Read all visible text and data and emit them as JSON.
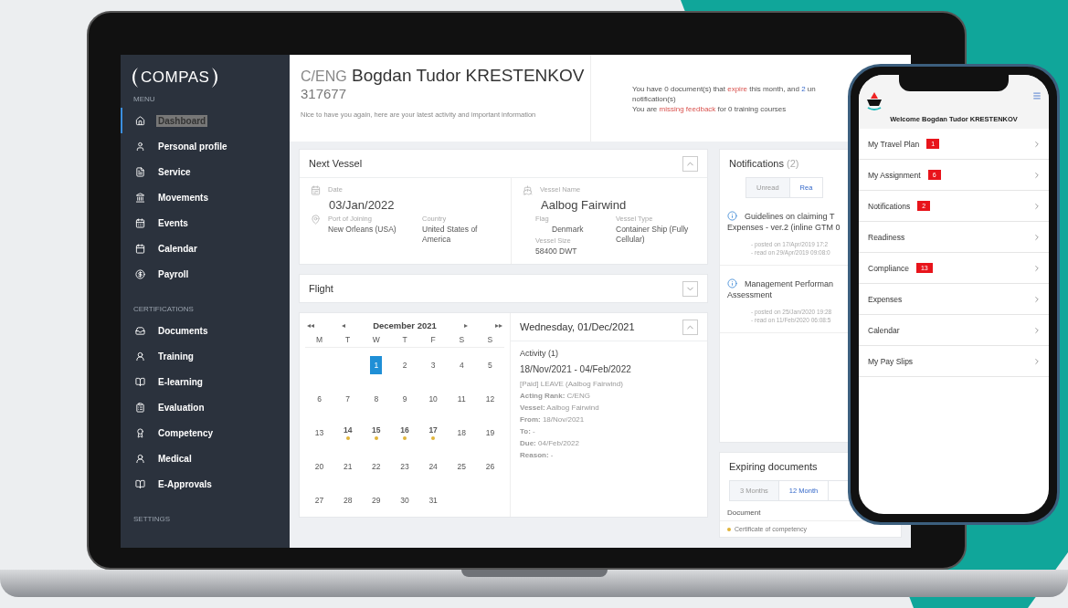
{
  "sidebar": {
    "logo": "COMPAS",
    "sections": [
      {
        "title": "MENU",
        "items": [
          {
            "label": "Dashboard",
            "selected": true
          },
          {
            "label": "Personal profile",
            "selected": false
          },
          {
            "label": "Service",
            "selected": false
          },
          {
            "label": "Movements",
            "selected": false
          },
          {
            "label": "Events",
            "selected": false
          },
          {
            "label": "Calendar",
            "selected": false
          },
          {
            "label": "Payroll",
            "selected": false
          }
        ]
      },
      {
        "title": "CERTIFICATIONS",
        "items": [
          {
            "label": "Documents",
            "selected": false
          },
          {
            "label": "Training",
            "selected": false
          },
          {
            "label": "E-learning",
            "selected": false
          },
          {
            "label": "Evaluation",
            "selected": false
          },
          {
            "label": "Competency",
            "selected": false
          },
          {
            "label": "Medical",
            "selected": false
          },
          {
            "label": "E-Approvals",
            "selected": false
          }
        ]
      },
      {
        "title": "SETTINGS"
      }
    ]
  },
  "header": {
    "rank": "C/ENG",
    "name": "Bogdan Tudor KRESTENKOV",
    "id": "317677",
    "greeting": "Nice to have you again, here are your latest activity and important information",
    "notice_lines": [
      [
        {
          "text": "You have 0 document(s) that ",
          "kind": "plain"
        },
        {
          "text": "expire",
          "kind": "alert"
        },
        {
          "text": " this month, and ",
          "kind": "plain"
        },
        {
          "text": "2",
          "kind": "link"
        },
        {
          "text": " un",
          "kind": "plain"
        }
      ],
      [
        {
          "text": "notification(s)",
          "kind": "plain"
        }
      ],
      [
        {
          "text": "You are ",
          "kind": "plain"
        },
        {
          "text": "missing feedback",
          "kind": "alert"
        },
        {
          "text": " for 0 training courses",
          "kind": "plain"
        }
      ]
    ]
  },
  "next_vessel": {
    "title": "Next Vessel",
    "expanded": true,
    "date_label": "Date",
    "date": "03/Jan/2022",
    "port_label": "Port of Joining",
    "port": "New Orleans (USA)",
    "country_label": "Country",
    "country": "United States of America",
    "vessel_label": "Vessel Name",
    "vessel": "Aalbog Fairwind",
    "flag_label": "Flag",
    "flag": "Denmark",
    "type_label": "Vessel Type",
    "type": "Container Ship (Fully Cellular)",
    "size_label": "Vessel Size",
    "size": "58400 DWT"
  },
  "flight": {
    "title": "Flight",
    "expanded": false
  },
  "calendar": {
    "nav": [
      "◂◂",
      "◂",
      "▸",
      "▸▸"
    ],
    "month": "December 2021",
    "weekdays": [
      "M",
      "T",
      "W",
      "T",
      "F",
      "S",
      "S"
    ],
    "days": [
      {
        "day": "1",
        "selected": true,
        "event": false
      },
      {
        "day": "2",
        "selected": false,
        "event": false
      },
      {
        "day": "3",
        "selected": false,
        "event": false
      },
      {
        "day": "4",
        "selected": false,
        "event": false
      },
      {
        "day": "5",
        "selected": false,
        "event": false
      },
      {
        "day": "6",
        "selected": false,
        "event": false
      },
      {
        "day": "7",
        "selected": false,
        "event": false
      },
      {
        "day": "8",
        "selected": false,
        "event": false
      },
      {
        "day": "9",
        "selected": false,
        "event": false
      },
      {
        "day": "10",
        "selected": false,
        "event": false
      },
      {
        "day": "11",
        "selected": false,
        "event": false
      },
      {
        "day": "12",
        "selected": false,
        "event": false
      },
      {
        "day": "13",
        "selected": false,
        "event": false
      },
      {
        "day": "14",
        "selected": false,
        "event": true
      },
      {
        "day": "15",
        "selected": false,
        "event": true
      },
      {
        "day": "16",
        "selected": false,
        "event": true
      },
      {
        "day": "17",
        "selected": false,
        "event": true
      },
      {
        "day": "18",
        "selected": false,
        "event": false
      },
      {
        "day": "19",
        "selected": false,
        "event": false
      },
      {
        "day": "20",
        "selected": false,
        "event": false
      },
      {
        "day": "21",
        "selected": false,
        "event": false
      },
      {
        "day": "22",
        "selected": false,
        "event": false
      },
      {
        "day": "23",
        "selected": false,
        "event": false
      },
      {
        "day": "24",
        "selected": false,
        "event": false
      },
      {
        "day": "25",
        "selected": false,
        "event": false
      },
      {
        "day": "26",
        "selected": false,
        "event": false
      },
      {
        "day": "27",
        "selected": false,
        "event": false
      },
      {
        "day": "28",
        "selected": false,
        "event": false
      },
      {
        "day": "29",
        "selected": false,
        "event": false
      },
      {
        "day": "30",
        "selected": false,
        "event": false
      },
      {
        "day": "31",
        "selected": false,
        "event": false
      }
    ]
  },
  "day_panel": {
    "title": "Wednesday, 01/Dec/2021",
    "expanded": true,
    "activity_title": "Activity (1)",
    "period": "18/Nov/2021 - 04/Feb/2022",
    "lines": [
      "[Paid] LEAVE (Aalbog Fairwind)",
      "**Acting Rank:** C/ENG",
      "**Vessel:** Aalbog Fairwind",
      "**From:** 18/Nov/2021",
      "**To:** -",
      "**Due:** 04/Feb/2022",
      "**Reason:** -"
    ]
  },
  "notifications": {
    "title": "Notifications",
    "count": "(2)",
    "tabs": [
      {
        "label": "Unread",
        "selected": true
      },
      {
        "label": "Rea",
        "selected": false
      }
    ],
    "items": [
      {
        "lines": [
          "Guidelines on claiming T",
          "Expenses - ver.2 (inline GTM 0"
        ],
        "posted": "- posted on 17/Apr/2019 17:2",
        "read": "- read on 29/Apr/2019 09:08:0"
      },
      {
        "lines": [
          "Management Performan",
          "Assessment"
        ],
        "posted": "- posted on 25/Jan/2020 19:28",
        "read": "- read on 11/Feb/2020 06:08:5"
      }
    ]
  },
  "expiring": {
    "title": "Expiring documents",
    "tabs": [
      {
        "label": "3 Months",
        "selected": true
      },
      {
        "label": "12 Month",
        "selected": false
      }
    ],
    "column": "Document",
    "rows": [
      "Certificate of competency"
    ]
  },
  "phone": {
    "welcome": "Welcome Bogdan Tudor KRESTENKOV",
    "items": [
      {
        "label": "My Travel Plan",
        "badge": "1"
      },
      {
        "label": "My Assignment",
        "badge": "6"
      },
      {
        "label": "Notifications",
        "badge": "2"
      },
      {
        "label": "Readiness"
      },
      {
        "label": "Compliance",
        "badge": "13"
      },
      {
        "label": "Expenses"
      },
      {
        "label": "Calendar"
      },
      {
        "label": "My Pay Slips"
      }
    ]
  }
}
